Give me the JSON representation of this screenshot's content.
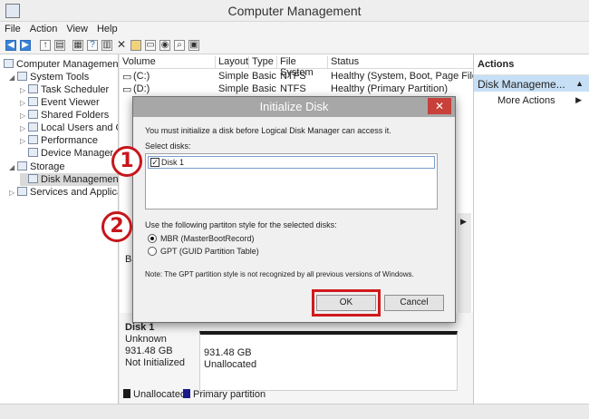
{
  "window": {
    "title": "Computer Management"
  },
  "menu": [
    "File",
    "Action",
    "View",
    "Help"
  ],
  "toolbar_icons": [
    "back-icon",
    "forward-icon",
    "up-icon",
    "console-tree-icon",
    "properties-icon",
    "help-icon",
    "refresh-icon",
    "export-icon",
    "delete-icon",
    "folder-icon",
    "disk-icon",
    "search-icon",
    "view-icon"
  ],
  "tree": {
    "root": "Computer Management",
    "system_tools": "System Tools",
    "task_scheduler": "Task Scheduler",
    "event_viewer": "Event Viewer",
    "shared_folders": "Shared Folders",
    "local_users": "Local Users and Gr",
    "performance": "Performance",
    "device_manager": "Device Manager",
    "storage": "Storage",
    "disk_management": "Disk Management",
    "services": "Services and Applicat"
  },
  "volume_list": {
    "headers": [
      "Volume",
      "Layout",
      "Type",
      "File System",
      "Status"
    ],
    "rows": [
      [
        "(C:)",
        "Simple",
        "Basic",
        "NTFS",
        "Healthy (System, Boot, Page File, Ac"
      ],
      [
        "(D:)",
        "Simple",
        "Basic",
        "NTFS",
        "Healthy (Primary Partition)"
      ]
    ]
  },
  "disk_pane": {
    "partial_label": "Ba",
    "disk_name": "Disk 1",
    "disk_kind": "Unknown",
    "disk_size": "931.48 GB",
    "disk_state": "Not Initialized",
    "partition_size": "931.48 GB",
    "partition_state": "Unallocated"
  },
  "legend": {
    "unallocated": "Unallocated",
    "primary": "Primary partition",
    "unallocated_color": "#1a1a1a",
    "primary_color": "#1a1a8c"
  },
  "actions": {
    "header": "Actions",
    "selected": "Disk Manageme...",
    "more": "More Actions"
  },
  "dialog": {
    "title": "Initialize Disk",
    "close": "✕",
    "message": "You must initialize a disk before Logical Disk Manager can access it.",
    "select_label": "Select disks:",
    "disk_item": "Disk 1",
    "disk_checked": true,
    "style_label": "Use the following partiton style for the selected disks:",
    "mbr_label": "MBR (MasterBootRecord)",
    "gpt_label": "GPT (GUID Partition Table)",
    "selected_style": "MBR",
    "note": "Note: The GPT partition style is not recognized by all previous versions of Windows.",
    "ok": "OK",
    "cancel": "Cancel"
  },
  "callouts": [
    "1",
    "2"
  ],
  "highlight_color": "#d0191c"
}
